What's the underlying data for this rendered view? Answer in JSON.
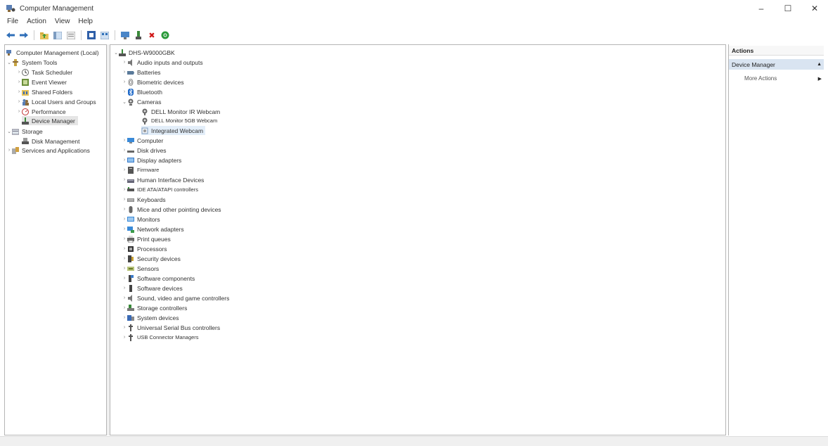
{
  "window": {
    "title": "Computer Management",
    "minimize": "–",
    "maximize": "☐",
    "close": "✕"
  },
  "menu": [
    "File",
    "Action",
    "View",
    "Help"
  ],
  "toolbar": {
    "icons": [
      "back-arrow-icon",
      "forward-arrow-icon",
      "up-folder-icon",
      "show-hide-tree-icon",
      "properties-icon",
      "help-icon",
      "view-icon",
      "monitor-icon",
      "update-driver-icon",
      "uninstall-icon",
      "scan-hardware-icon"
    ],
    "delete_glyph": "✖",
    "scan_glyph": "●"
  },
  "left_tree": {
    "root": "Computer Management (Local)",
    "system_tools": "System Tools",
    "items": [
      "Task Scheduler",
      "Event Viewer",
      "Shared Folders",
      "Local Users and Groups",
      "Performance",
      "Device Manager"
    ],
    "storage": "Storage",
    "storage_items": [
      "Disk Management"
    ],
    "services": "Services and Applications"
  },
  "device_tree": {
    "root": "DHS-W9000GBK",
    "categories_top": [
      "Audio inputs and outputs",
      "Batteries",
      "Biometric devices",
      "Bluetooth",
      "Cameras"
    ],
    "camera_children": [
      "DELL Monitor IR Webcam",
      "DELL Monitor 5GB Webcam",
      "Integrated Webcam"
    ],
    "categories_bottom": [
      "Computer",
      "Disk drives",
      "Display adapters",
      "Firmware",
      "Human Interface Devices",
      "IDE ATA/ATAPI controllers",
      "Keyboards",
      "Mice and other pointing devices",
      "Monitors",
      "Network adapters",
      "Print queues",
      "Processors",
      "Security devices",
      "Sensors",
      "Software components",
      "Software devices",
      "Sound, video and game controllers",
      "Storage controllers",
      "System devices",
      "Universal Serial Bus controllers",
      "USB Connector Managers"
    ]
  },
  "actions": {
    "header": "Actions",
    "section": "Device Manager",
    "more": "More Actions"
  }
}
